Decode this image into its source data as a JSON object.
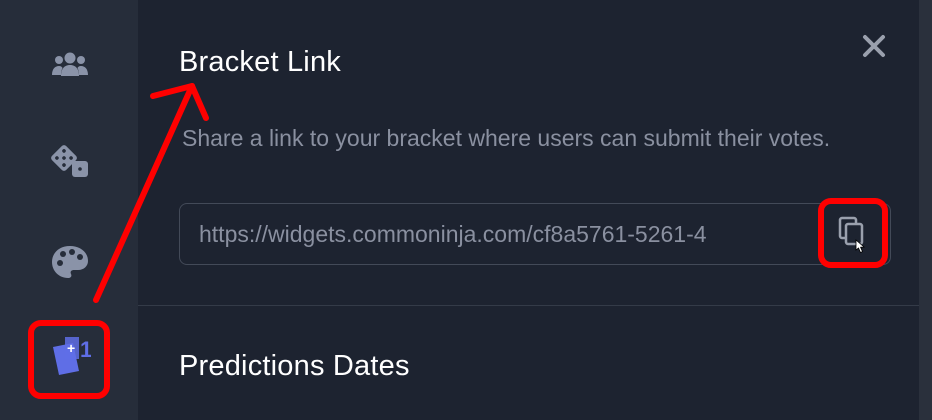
{
  "sidebar": {
    "items": [
      {
        "icon": "users-icon"
      },
      {
        "icon": "dice-icon"
      },
      {
        "icon": "palette-icon"
      },
      {
        "icon": "add-vote-icon",
        "active": true
      }
    ]
  },
  "panel": {
    "close_icon": "close-icon",
    "bracket_link": {
      "title": "Bracket Link",
      "description": "Share a link to your bracket where users can submit their votes.",
      "url": "https://widgets.commoninja.com/cf8a5761-5261-4",
      "copy_icon": "copy-icon"
    },
    "predictions": {
      "title": "Predictions Dates"
    }
  },
  "colors": {
    "background": "#1d2330",
    "sidebar": "#262d3a",
    "icon": "#8a93a8",
    "active_icon": "#5f6ee6",
    "annotation": "#ff0000"
  }
}
